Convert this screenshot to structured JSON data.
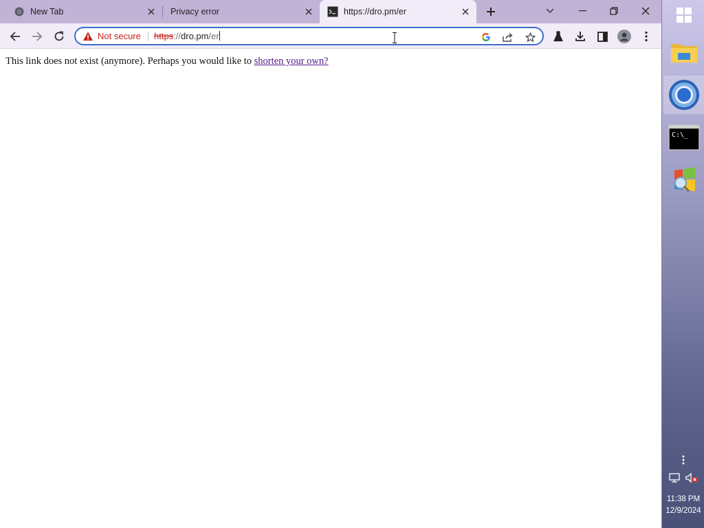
{
  "browser": {
    "tabs": [
      {
        "label": "New Tab",
        "icon": "chrome-icon"
      },
      {
        "label": "Privacy error",
        "icon": "none"
      },
      {
        "label": "https://dro.pm/er",
        "icon": "terminal-favicon-icon",
        "active": true
      }
    ],
    "window_controls": [
      "tab-search-icon",
      "minimize-icon",
      "restore-icon",
      "close-icon"
    ]
  },
  "toolbar": {
    "nav_icons": [
      "back-arrow-icon",
      "forward-arrow-icon",
      "reload-icon"
    ],
    "omnibox": {
      "security_label": "Not secure",
      "url_scheme": "https",
      "url_sep": "://",
      "url_host": "dro.pm",
      "url_path": "/er",
      "icons": [
        "google-icon",
        "share-icon",
        "bookmark-star-icon"
      ]
    },
    "right_icons": [
      "labs-flask-icon",
      "download-icon",
      "side-panel-icon",
      "profile-avatar-icon",
      "more-menu-icon"
    ]
  },
  "page": {
    "message": "This link does not exist (anymore). Perhaps you would like to",
    "link_text": "shorten your own?"
  },
  "taskbar": {
    "apps": [
      "start-menu-icon",
      "file-explorer-icon",
      "chrome-icon",
      "command-prompt-icon",
      "windows-update-icon"
    ],
    "time": "11:38 PM",
    "date": "12/9/2024"
  },
  "colors": {
    "tabstrip": "#c1b3d6",
    "toolbar": "#f1ecf7",
    "omnibox_border": "#3d6ec8",
    "warning_red": "#c5221f",
    "link_visited": "#551a8b"
  }
}
